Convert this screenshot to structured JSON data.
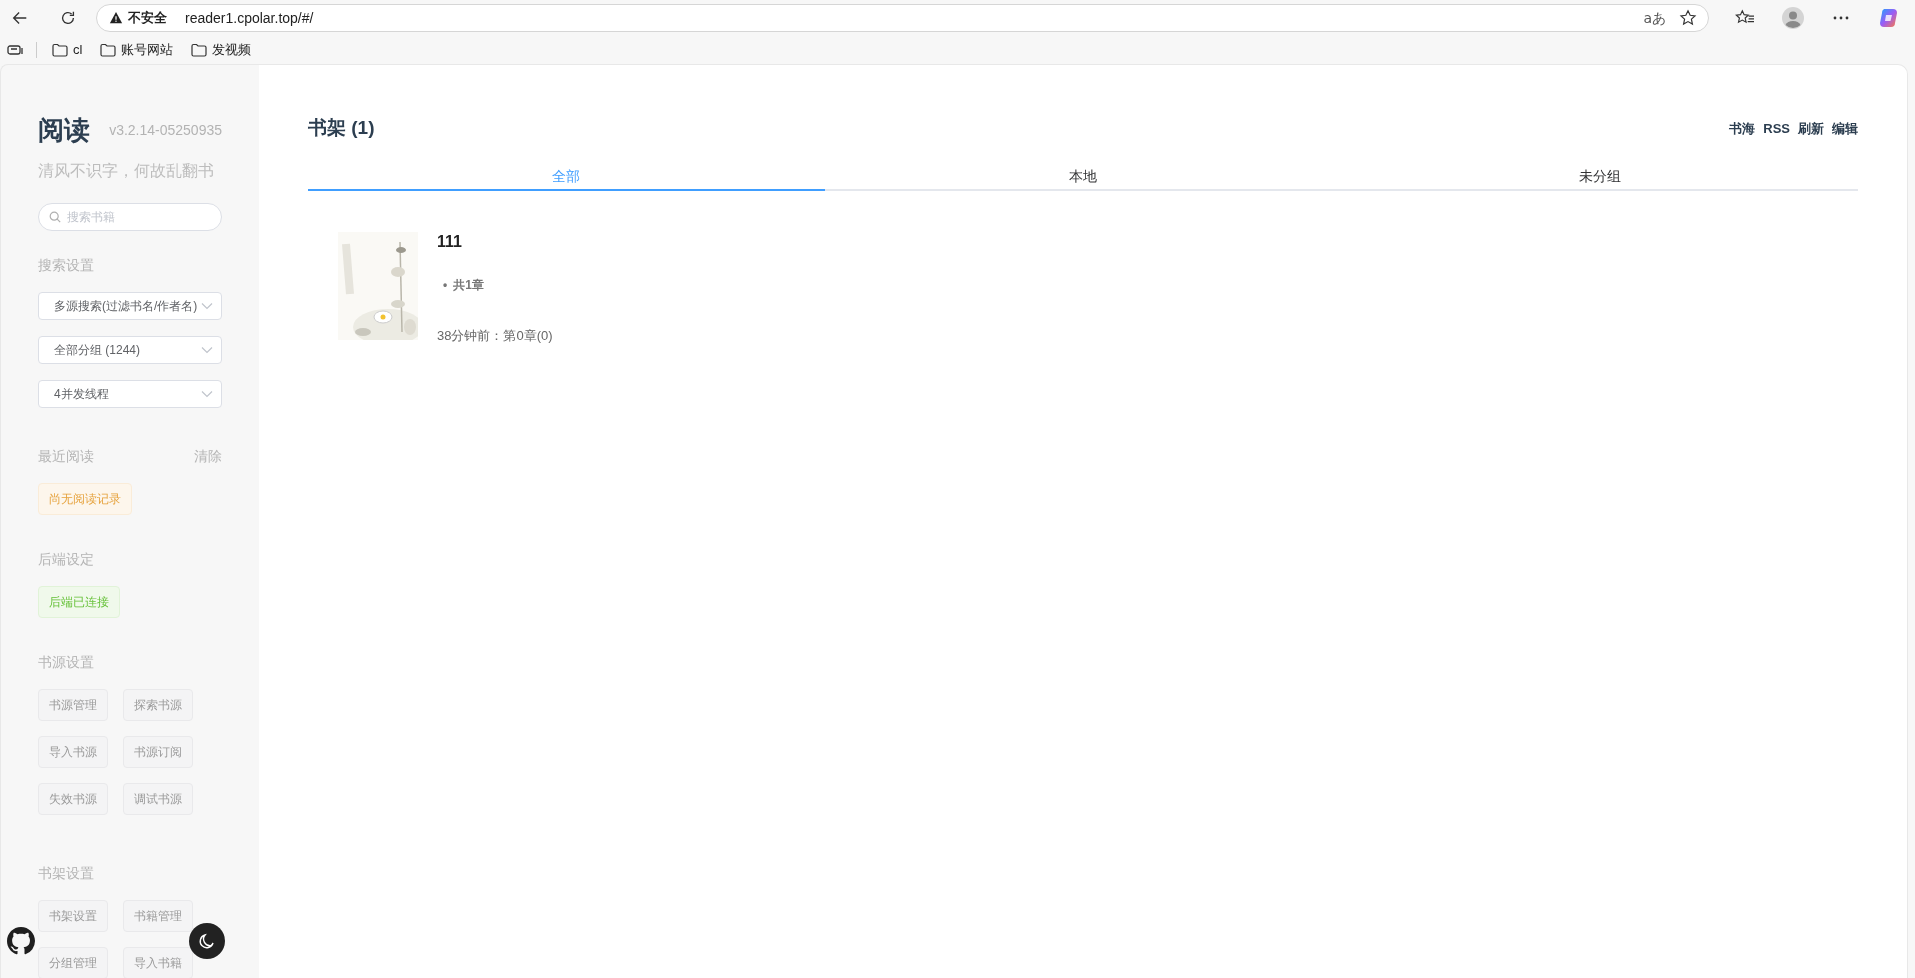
{
  "browser": {
    "security_label": "不安全",
    "url": "reader1.cpolar.top/#/",
    "translate_label": "aあ",
    "bookmarks": [
      {
        "label": "cl"
      },
      {
        "label": "账号网站"
      },
      {
        "label": "发视频"
      }
    ]
  },
  "sidebar": {
    "app_title": "阅读",
    "version": "v3.2.14-05250935",
    "motto": "清风不识字，何故乱翻书",
    "search": {
      "placeholder": "搜索书籍"
    },
    "search_settings": {
      "title": "搜索设置",
      "selects": [
        {
          "value": "多源搜索(过滤书名/作者名)"
        },
        {
          "value": "全部分组 (1244)"
        },
        {
          "value": "4并发线程"
        }
      ]
    },
    "recent": {
      "title": "最近阅读",
      "clear": "清除",
      "tag": {
        "label": "尚无阅读记录",
        "kind": "warning"
      }
    },
    "backend": {
      "title": "后端设定",
      "tag": {
        "label": "后端已连接",
        "kind": "success"
      }
    },
    "source_settings": {
      "title": "书源设置",
      "buttons": [
        "书源管理",
        "探索书源",
        "导入书源",
        "书源订阅",
        "失效书源",
        "调试书源"
      ]
    },
    "shelf_settings": {
      "title": "书架设置",
      "buttons": [
        "书架设置",
        "书籍管理",
        "分组管理",
        "导入书籍"
      ]
    }
  },
  "main": {
    "title": "书架 (1)",
    "actions": [
      "书海",
      "RSS",
      "刷新",
      "编辑"
    ],
    "tabs": [
      {
        "label": "全部",
        "selected": true
      },
      {
        "label": "本地",
        "selected": false
      },
      {
        "label": "未分组",
        "selected": false
      }
    ],
    "books": [
      {
        "title": "111",
        "separator": "•",
        "chapters": "共1章",
        "last_read": "38分钟前：第0章(0)"
      }
    ]
  }
}
